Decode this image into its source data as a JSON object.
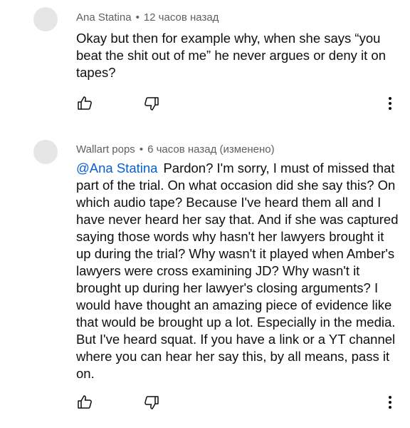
{
  "comments": [
    {
      "author": "Ana Statina",
      "separator": "•",
      "time": "12 часов назад",
      "text": "Okay but then for example why, when she says “you beat the shit out of me” he never argues or deny it on tapes?",
      "actions": {
        "like_icon": "thumbs-up-icon",
        "dislike_icon": "thumbs-down-icon",
        "menu_icon": "more-vert-icon"
      }
    },
    {
      "author": "Wallart pops",
      "separator": "•",
      "time": "6 часов назад (изменено)",
      "mention": "@Ana Statina",
      "text": "Pardon? I'm sorry, I must of missed that part of the trial. On what occasion did she say this? On which audio tape? Because I've heard them all and I have never heard her say that. And if she was captured saying those words why hasn't her lawyers brought it up during the trial? Why wasn't it played when Amber's lawyers were cross examining JD? Why wasn't it brought up during her lawyer's closing arguments? I would have thought an amazing piece of evidence like that would be brought up a lot. Especially in the media. But I've heard squat. If you have a link or a YT channel where you can hear her say this, by all means, pass it on.",
      "actions": {
        "like_icon": "thumbs-up-icon",
        "dislike_icon": "thumbs-down-icon",
        "menu_icon": "more-vert-icon"
      }
    }
  ],
  "colors": {
    "meta": "#606060",
    "text": "#0f0f0f",
    "mention": "#065fd4",
    "avatar": "#e6e6e6"
  }
}
